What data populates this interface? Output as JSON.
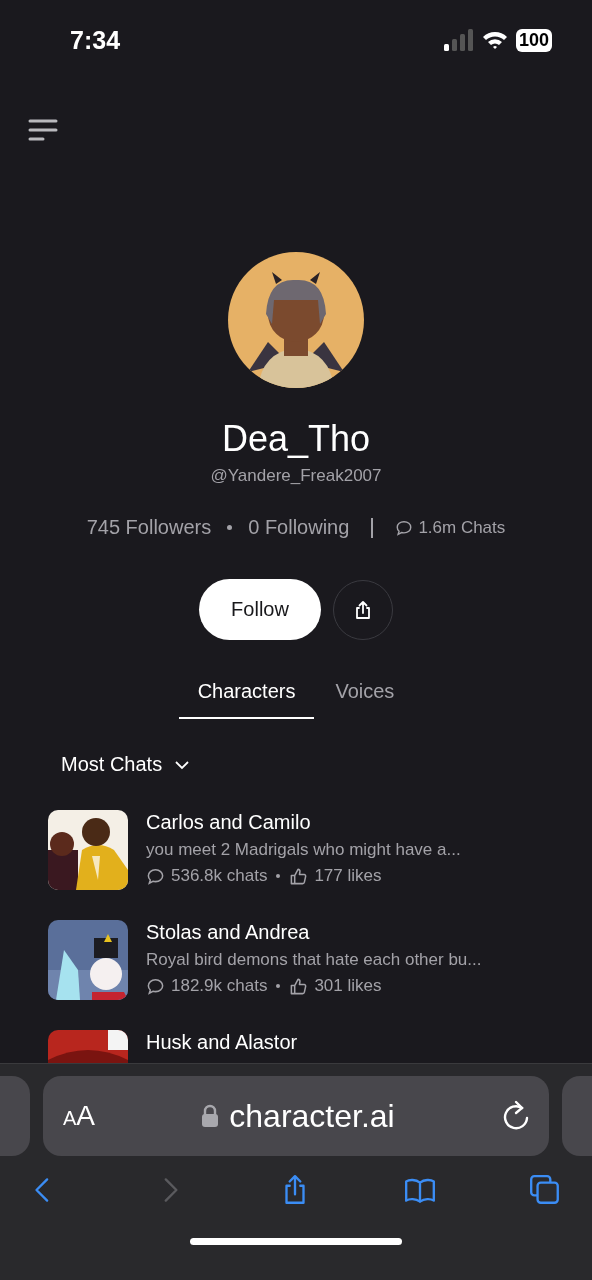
{
  "status_bar": {
    "time": "7:34",
    "battery": "100"
  },
  "profile": {
    "name": "Dea_Tho",
    "handle": "@Yandere_Freak2007",
    "followers": "745 Followers",
    "following": "0 Following",
    "chats": "1.6m Chats"
  },
  "actions": {
    "follow": "Follow"
  },
  "tabs": [
    {
      "label": "Characters",
      "selected": true
    },
    {
      "label": "Voices",
      "selected": false
    }
  ],
  "sort": {
    "label": "Most Chats"
  },
  "characters": [
    {
      "name": "Carlos and Camilo",
      "description": "you meet 2 Madrigals who might have a...",
      "chats": "536.8k chats",
      "likes": "177 likes"
    },
    {
      "name": "Stolas and Andrea",
      "description": "Royal bird demons that hate each other bu...",
      "chats": "182.9k chats",
      "likes": "301 likes"
    },
    {
      "name": "Husk and Alastor"
    }
  ],
  "browser": {
    "text_size": "AA",
    "url": "character.ai"
  },
  "toolbar": [
    {
      "kind": "back",
      "disabled": false
    },
    {
      "kind": "forward",
      "disabled": true
    },
    {
      "kind": "share",
      "disabled": false
    },
    {
      "kind": "bookmarks",
      "disabled": false
    },
    {
      "kind": "tabs",
      "disabled": false
    }
  ]
}
